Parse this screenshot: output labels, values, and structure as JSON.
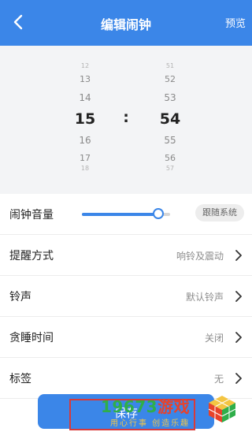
{
  "header": {
    "title": "编辑闹钟",
    "preview_label": "预览"
  },
  "picker": {
    "hours": [
      "12",
      "13",
      "14",
      "15",
      "16",
      "17",
      "18"
    ],
    "minutes": [
      "51",
      "52",
      "53",
      "54",
      "55",
      "56",
      "57"
    ],
    "selected_hour": "15",
    "selected_minute": "54",
    "separator": ":"
  },
  "settings": {
    "volume": {
      "label": "闹钟音量",
      "level_percent": 87,
      "follow_system_label": "跟随系统"
    },
    "reminder": {
      "label": "提醒方式",
      "value": "响铃及震动"
    },
    "ringtone": {
      "label": "铃声",
      "value": "默认铃声"
    },
    "snooze": {
      "label": "贪睡时间",
      "value": "关闭"
    },
    "tag": {
      "label": "标签",
      "value": "无"
    }
  },
  "save_label": "保存",
  "watermark": {
    "brand_digits": "19673",
    "brand_game": "游戏",
    "slogan": "用心行事 创造乐趣"
  },
  "colors": {
    "accent": "#3b86e8",
    "picker_bg": "#f3f4f6",
    "secondary_text": "#8c8c8c"
  }
}
